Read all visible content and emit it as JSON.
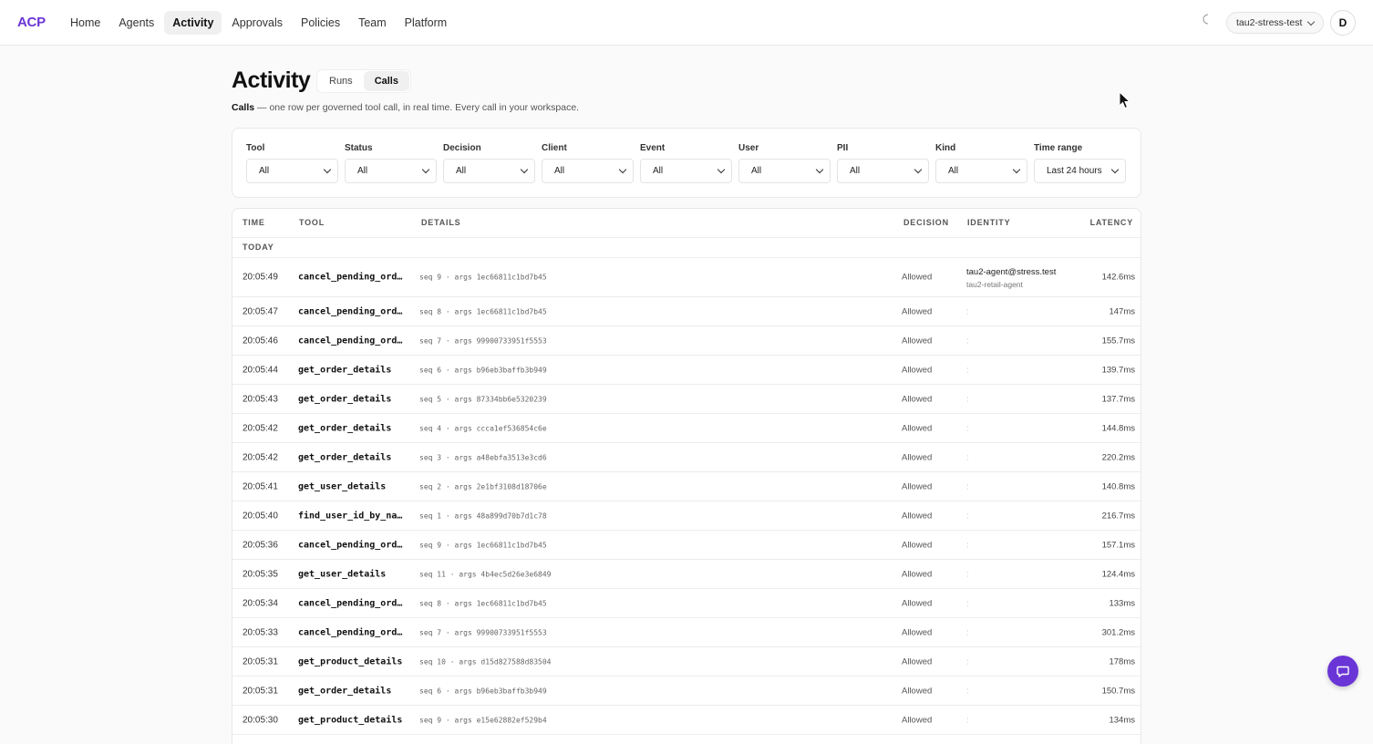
{
  "nav": {
    "logo": "ACP",
    "items": [
      {
        "label": "Home",
        "active": false
      },
      {
        "label": "Agents",
        "active": false
      },
      {
        "label": "Activity",
        "active": true
      },
      {
        "label": "Approvals",
        "active": false
      },
      {
        "label": "Policies",
        "active": false
      },
      {
        "label": "Team",
        "active": false
      },
      {
        "label": "Platform",
        "active": false
      }
    ],
    "workspace": "tau2-stress-test",
    "avatar_initial": "D",
    "theme_icon": "moon-icon"
  },
  "page": {
    "title": "Activity",
    "tabs": [
      {
        "label": "Runs",
        "active": false
      },
      {
        "label": "Calls",
        "active": true
      }
    ],
    "subtitle_bold": "Calls",
    "subtitle_rest": " — one row per governed tool call, in real time. Every call in your workspace."
  },
  "filters": [
    {
      "label": "Tool",
      "value": "All"
    },
    {
      "label": "Status",
      "value": "All"
    },
    {
      "label": "Decision",
      "value": "All"
    },
    {
      "label": "Client",
      "value": "All"
    },
    {
      "label": "Event",
      "value": "All"
    },
    {
      "label": "User",
      "value": "All"
    },
    {
      "label": "PII",
      "value": "All"
    },
    {
      "label": "Kind",
      "value": "All"
    },
    {
      "label": "Time range",
      "value": "Last 24 hours"
    }
  ],
  "table": {
    "columns": {
      "time": "TIME",
      "tool": "TOOL",
      "details": "DETAILS",
      "decision": "DECISION",
      "identity": "IDENTITY",
      "latency": "LATENCY"
    },
    "group": "TODAY",
    "rows": [
      {
        "time": "20:05:49",
        "tool": "cancel_pending_ord…",
        "details": "seq 9 · args 1ec66811c1bd7b45",
        "decision": "Allowed",
        "identity": "tau2-agent@stress.test",
        "agent": "tau2-retail-agent",
        "latency": "142.6ms"
      },
      {
        "time": "20:05:47",
        "tool": "cancel_pending_ord…",
        "details": "seq 8 · args 1ec66811c1bd7b45",
        "decision": "Allowed",
        "identity": ":",
        "latency": "147ms"
      },
      {
        "time": "20:05:46",
        "tool": "cancel_pending_ord…",
        "details": "seq 7 · args 99900733951f5553",
        "decision": "Allowed",
        "identity": ":",
        "latency": "155.7ms"
      },
      {
        "time": "20:05:44",
        "tool": "get_order_details",
        "details": "seq 6 · args b96eb3baffb3b949",
        "decision": "Allowed",
        "identity": ":",
        "latency": "139.7ms"
      },
      {
        "time": "20:05:43",
        "tool": "get_order_details",
        "details": "seq 5 · args 87334bb6e5320239",
        "decision": "Allowed",
        "identity": ":",
        "latency": "137.7ms"
      },
      {
        "time": "20:05:42",
        "tool": "get_order_details",
        "details": "seq 4 · args ccca1ef536854c6e",
        "decision": "Allowed",
        "identity": ":",
        "latency": "144.8ms"
      },
      {
        "time": "20:05:42",
        "tool": "get_order_details",
        "details": "seq 3 · args a48ebfa3513e3cd6",
        "decision": "Allowed",
        "identity": ":",
        "latency": "220.2ms"
      },
      {
        "time": "20:05:41",
        "tool": "get_user_details",
        "details": "seq 2 · args 2e1bf3108d18706e",
        "decision": "Allowed",
        "identity": ":",
        "latency": "140.8ms"
      },
      {
        "time": "20:05:40",
        "tool": "find_user_id_by_na…",
        "details": "seq 1 · args 48a899d70b7d1c78",
        "decision": "Allowed",
        "identity": ":",
        "latency": "216.7ms"
      },
      {
        "time": "20:05:36",
        "tool": "cancel_pending_ord…",
        "details": "seq 9 · args 1ec66811c1bd7b45",
        "decision": "Allowed",
        "identity": ":",
        "latency": "157.1ms"
      },
      {
        "time": "20:05:35",
        "tool": "get_user_details",
        "details": "seq 11 · args 4b4ec5d26e3e6849",
        "decision": "Allowed",
        "identity": ":",
        "latency": "124.4ms"
      },
      {
        "time": "20:05:34",
        "tool": "cancel_pending_ord…",
        "details": "seq 8 · args 1ec66811c1bd7b45",
        "decision": "Allowed",
        "identity": ":",
        "latency": "133ms"
      },
      {
        "time": "20:05:33",
        "tool": "cancel_pending_ord…",
        "details": "seq 7 · args 99900733951f5553",
        "decision": "Allowed",
        "identity": ":",
        "latency": "301.2ms"
      },
      {
        "time": "20:05:31",
        "tool": "get_product_details",
        "details": "seq 10 · args d15d827588d83504",
        "decision": "Allowed",
        "identity": ":",
        "latency": "178ms"
      },
      {
        "time": "20:05:31",
        "tool": "get_order_details",
        "details": "seq 6 · args b96eb3baffb3b949",
        "decision": "Allowed",
        "identity": ":",
        "latency": "150.7ms"
      },
      {
        "time": "20:05:30",
        "tool": "get_product_details",
        "details": "seq 9 · args e15e62882ef529b4",
        "decision": "Allowed",
        "identity": ":",
        "latency": "134ms"
      }
    ]
  },
  "colors": {
    "brand": "#6a35d6",
    "background": "#fafafa"
  }
}
